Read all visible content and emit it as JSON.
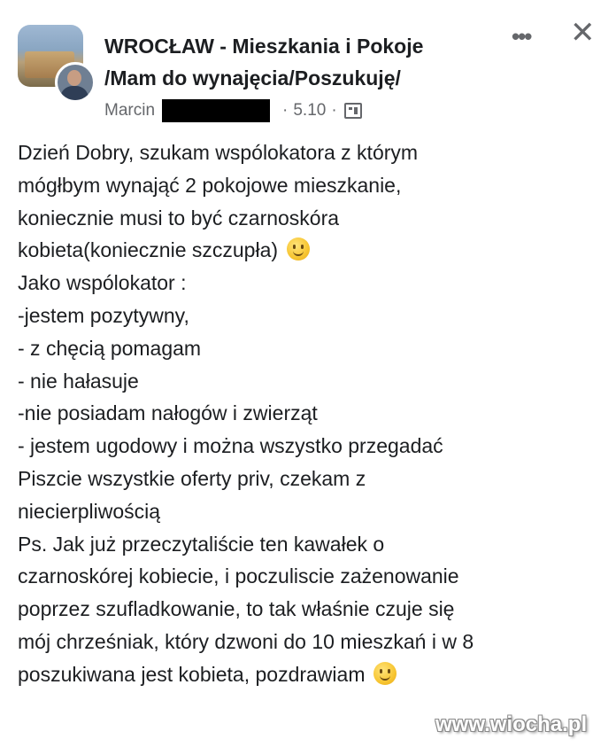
{
  "post": {
    "group_title_line1": "WROCŁAW  - Mieszkania i Pokoje",
    "group_title_line2": "/Mam do wynajęcia/Poszukuję/",
    "author": "Marcin",
    "date": "5.10",
    "privacy_icon": "globe-icon",
    "menu_icon": "more-icon",
    "close_icon": "close-icon",
    "lines": [
      "Dzień Dobry, szukam wspólokatora z którym",
      "mógłbym wynająć 2 pokojowe mieszkanie,",
      "koniecznie musi to być czarnoskóra",
      "kobieta(koniecznie szczupła)",
      "Jako wspólokator :",
      "-jestem pozytywny,",
      "- z chęcią pomagam",
      "- nie hałasuje",
      "-nie posiadam nałogów i zwierząt",
      "- jestem ugodowy i można wszystko przegadać",
      "Piszcie wszystkie oferty priv, czekam z",
      "niecierpliwością",
      "Ps. Jak już przeczytaliście ten kawałek o",
      "czarnoskórej kobiecie, i poczuliscie zażenowanie",
      "poprzez szufladkowanie, to tak właśnie czuje się",
      "mój chrześniak, który dzwoni do 10 mieszkań i w 8",
      "poszukiwana jest kobieta, pozdrawiam"
    ]
  },
  "watermark": "www.wiocha.pl",
  "colors": {
    "text": "#1c1e21",
    "secondary": "#65676b",
    "emoji": "#f7c531"
  }
}
